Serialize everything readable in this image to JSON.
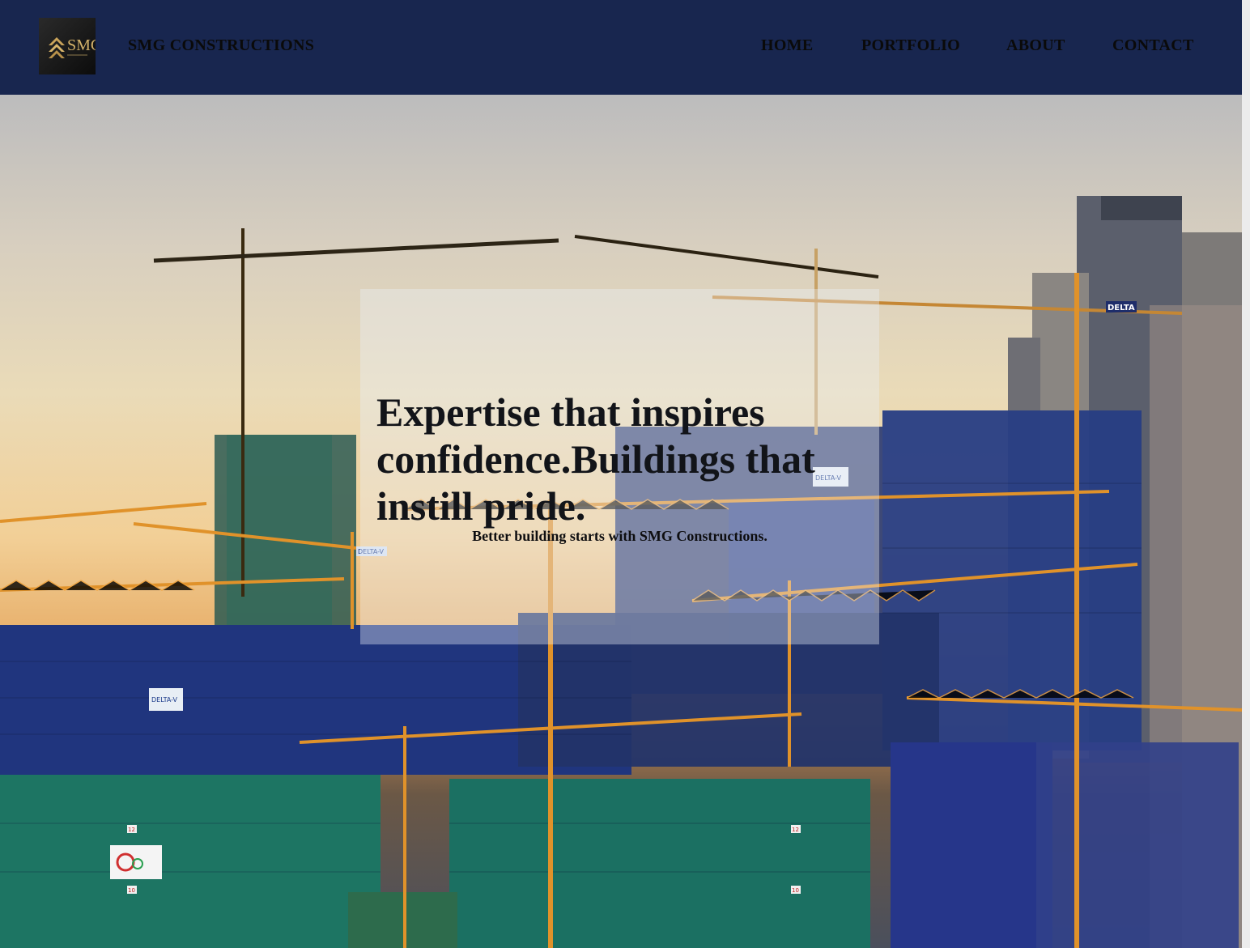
{
  "header": {
    "logo_text": "SMG",
    "brand": "SMG CONSTRUCTIONS",
    "nav": [
      {
        "label": "HOME"
      },
      {
        "label": "PORTFOLIO"
      },
      {
        "label": "ABOUT"
      },
      {
        "label": "CONTACT"
      }
    ]
  },
  "hero": {
    "headline": "Expertise that inspires confidence.Buildings that instill pride.",
    "subline": "Better building starts with SMG Constructions.",
    "signs": [
      "DELTA",
      "DELTA-V",
      "DELTA-V",
      "DELTA-V",
      "12",
      "12",
      "10",
      "10"
    ]
  },
  "colors": {
    "header_bg": "#18264f",
    "crane": "#e0922a",
    "net_blue": "#2a3f86",
    "net_green": "#1f7a68"
  }
}
